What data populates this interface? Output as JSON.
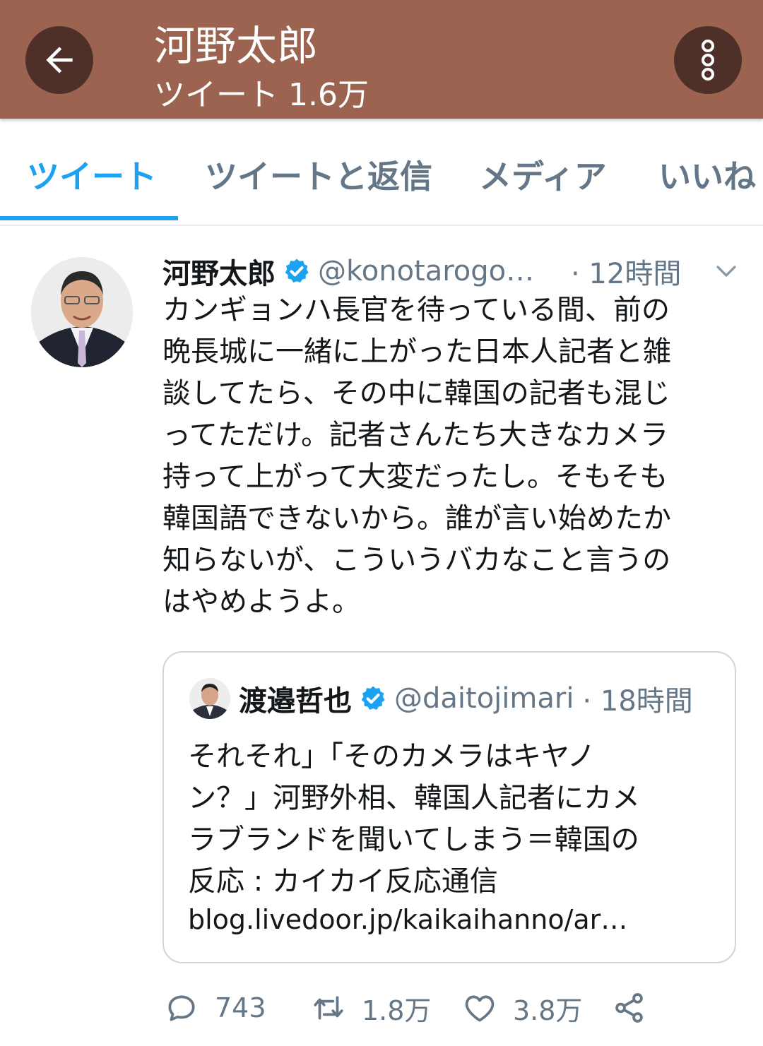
{
  "header": {
    "title": "河野太郎",
    "subtitle": "ツイート 1.6万",
    "colors": {
      "bar": "#9c6450",
      "button": "#4e3028"
    }
  },
  "tabs": [
    {
      "label": "ツイート",
      "active": true
    },
    {
      "label": "ツイートと返信",
      "active": false
    },
    {
      "label": "メディア",
      "active": false
    },
    {
      "label": "いいね",
      "active": false
    }
  ],
  "tweet": {
    "author_name": "河野太郎",
    "verified": true,
    "handle": "@konotarogo…",
    "time": "· 12時間",
    "lines": [
      "カンギョンハ長官を待っている間、前の",
      "晩長城に一緒に上がった日本人記者と雑",
      "談してたら、その中に韓国の記者も混じ",
      "ってただけ。記者さんたち大きなカメラ",
      "持って上がって大変だったし。そもそも",
      "韓国語できないから。誰が言い始めたか",
      "知らないが、こういうバカなこと言うの",
      "はやめようよ。"
    ]
  },
  "quote": {
    "author_name": "渡邉哲也",
    "verified": true,
    "handle": "@daitojimari",
    "time": "· 18時間",
    "lines": [
      "それそれ」「そのカメラはキヤノ",
      "ン？」河野外相、韓国人記者にカメ",
      "ラブランドを聞いてしまう＝韓国の",
      "反応 : カイカイ反応通信"
    ],
    "link": "blog.livedoor.jp/kaikaihanno/ar…"
  },
  "actions": {
    "reply_count": "743",
    "retweet_count": "1.8万",
    "like_count": "3.8万"
  },
  "icons": [
    "back-arrow-icon",
    "more-vertical-icon",
    "verified-badge-icon",
    "chevron-down-icon",
    "reply-icon",
    "retweet-icon",
    "like-icon",
    "share-icon"
  ],
  "accent_color": "#1da1f2"
}
